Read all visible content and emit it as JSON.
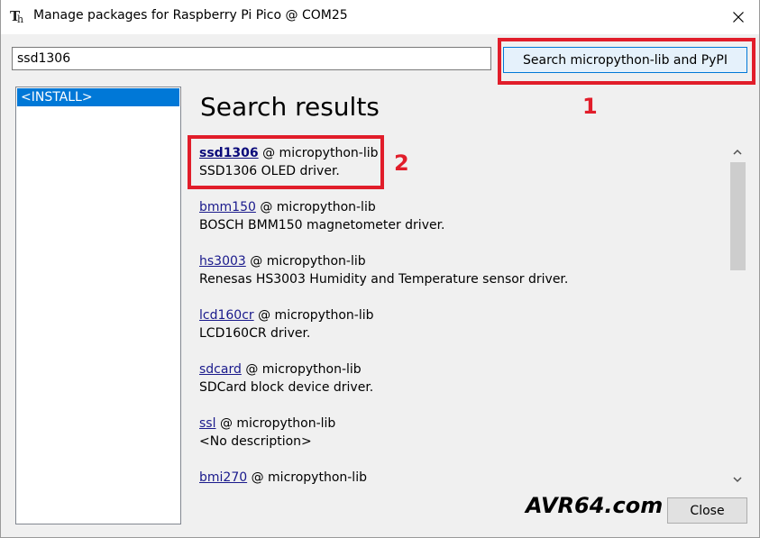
{
  "window": {
    "title": "Manage packages for Raspberry Pi Pico @ COM25"
  },
  "search": {
    "value": "ssd1306",
    "button_label": "Search micropython-lib and PyPI"
  },
  "sidebar": {
    "items": [
      {
        "label": "<INSTALL>",
        "selected": true
      }
    ]
  },
  "results": {
    "title": "Search results",
    "items": [
      {
        "name": "ssd1306",
        "source": "@ micropython-lib",
        "description": "SSD1306 OLED driver."
      },
      {
        "name": "bmm150",
        "source": "@ micropython-lib",
        "description": "BOSCH BMM150 magnetometer driver."
      },
      {
        "name": "hs3003",
        "source": "@ micropython-lib",
        "description": "Renesas HS3003 Humidity and Temperature sensor driver."
      },
      {
        "name": "lcd160cr",
        "source": "@ micropython-lib",
        "description": "LCD160CR driver."
      },
      {
        "name": "sdcard",
        "source": "@ micropython-lib",
        "description": "SDCard block device driver."
      },
      {
        "name": "ssl",
        "source": "@ micropython-lib",
        "description": "<No description>"
      },
      {
        "name": "bmi270",
        "source": "@ micropython-lib",
        "description": ""
      }
    ]
  },
  "annotations": {
    "one": "1",
    "two": "2",
    "color": "#e11d2a"
  },
  "watermark": "AVR64.com",
  "footer": {
    "close_label": "Close"
  },
  "icons": {
    "app": "thonny-icon",
    "close": "close-icon",
    "scroll_up": "chevron-up-icon",
    "scroll_down": "chevron-down-icon"
  }
}
